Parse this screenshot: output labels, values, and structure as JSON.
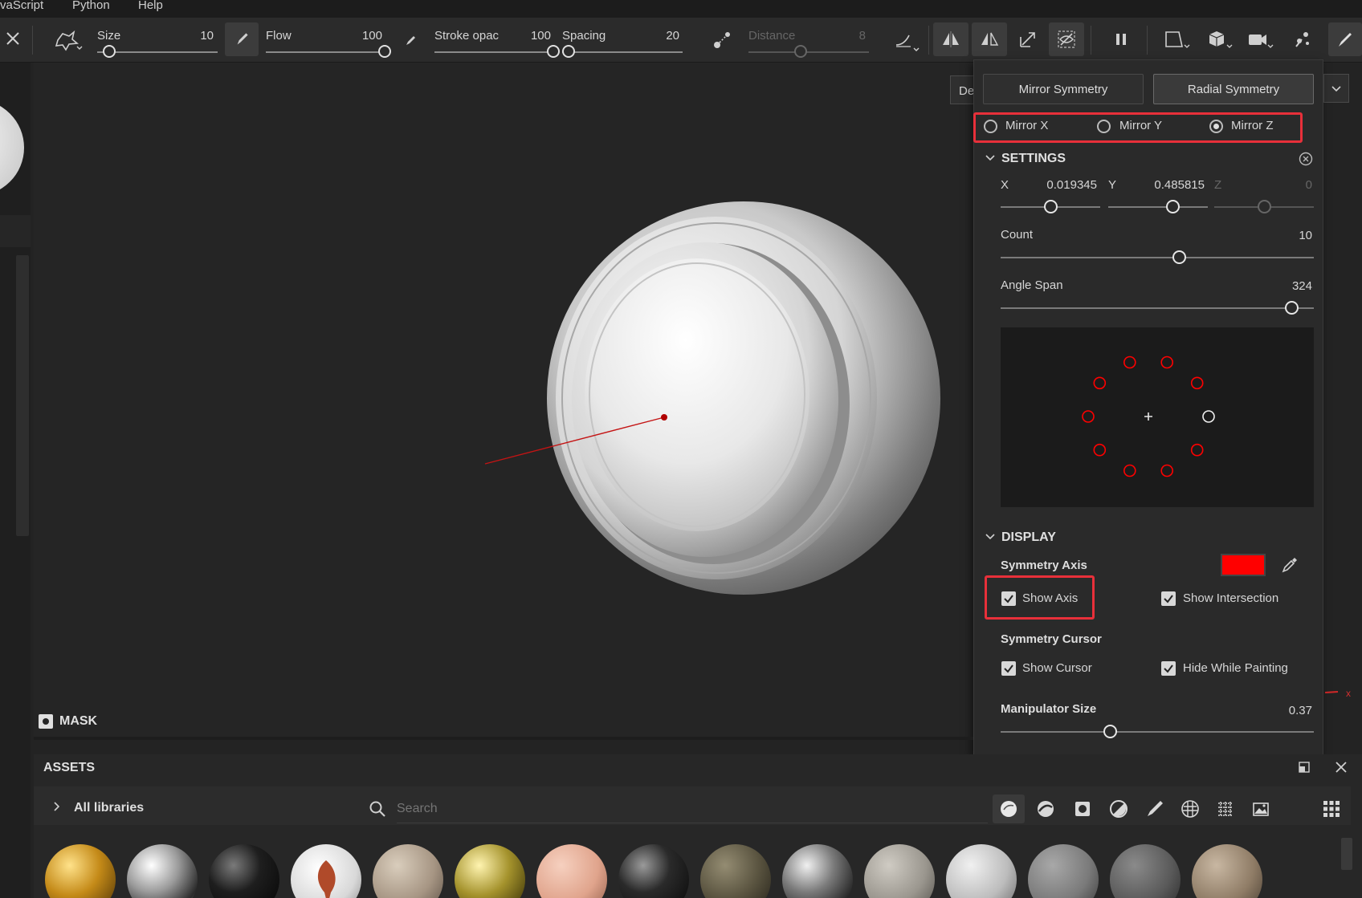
{
  "menu": {
    "items": [
      "vaScript",
      "Python",
      "Help"
    ]
  },
  "toolbar": {
    "size": {
      "label": "Size",
      "value": "10",
      "level": 0.1
    },
    "flow": {
      "label": "Flow",
      "value": "100",
      "level": 1.0
    },
    "stroke_opacity": {
      "label": "Stroke opac",
      "value": "100",
      "level": 1.0
    },
    "spacing": {
      "label": "Spacing",
      "value": "20",
      "level": 0.05
    },
    "distance": {
      "label": "Distance",
      "value": "8",
      "level": 0.43
    }
  },
  "viewport": {
    "mask_label": "MASK",
    "axis_gizmo_label": "x",
    "partial_button": "De"
  },
  "symmetry_panel": {
    "tabs": {
      "mirror": "Mirror Symmetry",
      "radial": "Radial Symmetry"
    },
    "mirror_options": [
      {
        "label": "Mirror X",
        "selected": false
      },
      {
        "label": "Mirror Y",
        "selected": false
      },
      {
        "label": "Mirror Z",
        "selected": true
      }
    ],
    "settings": {
      "heading": "SETTINGS",
      "x_label": "X",
      "x_value": "0.019345",
      "x_level": 0.5,
      "y_label": "Y",
      "y_value": "0.485815",
      "y_level": 0.65,
      "z_label": "Z",
      "z_value": "0",
      "z_level": 0.5,
      "count_label": "Count",
      "count_value": "10",
      "count_level": 0.57,
      "angle_label": "Angle Span",
      "angle_value": "324",
      "angle_level": 0.93
    },
    "display": {
      "heading": "DISPLAY",
      "symmetry_axis_label": "Symmetry Axis",
      "axis_color": "#ff0000",
      "show_axis": "Show Axis",
      "show_intersection": "Show Intersection",
      "symmetry_cursor_label": "Symmetry Cursor",
      "show_cursor": "Show Cursor",
      "hide_while_painting": "Hide While Painting",
      "manipulator_label": "Manipulator Size",
      "manipulator_value": "0.37",
      "manipulator_level": 0.35
    }
  },
  "assets": {
    "title": "ASSETS",
    "libraries": "All libraries",
    "search_placeholder": "Search",
    "balls": [
      "gold-hex",
      "chrome",
      "black-gloss",
      "leaf-decal",
      "beige-plastic",
      "brass",
      "skin",
      "carbon-fiber",
      "dark-bronze",
      "chrome-dark",
      "concrete",
      "light-grey",
      "grey-rough",
      "dark-grey",
      "tan"
    ]
  },
  "colors": {
    "accent_red": "#e8303a",
    "axis_red": "#ff0000"
  }
}
